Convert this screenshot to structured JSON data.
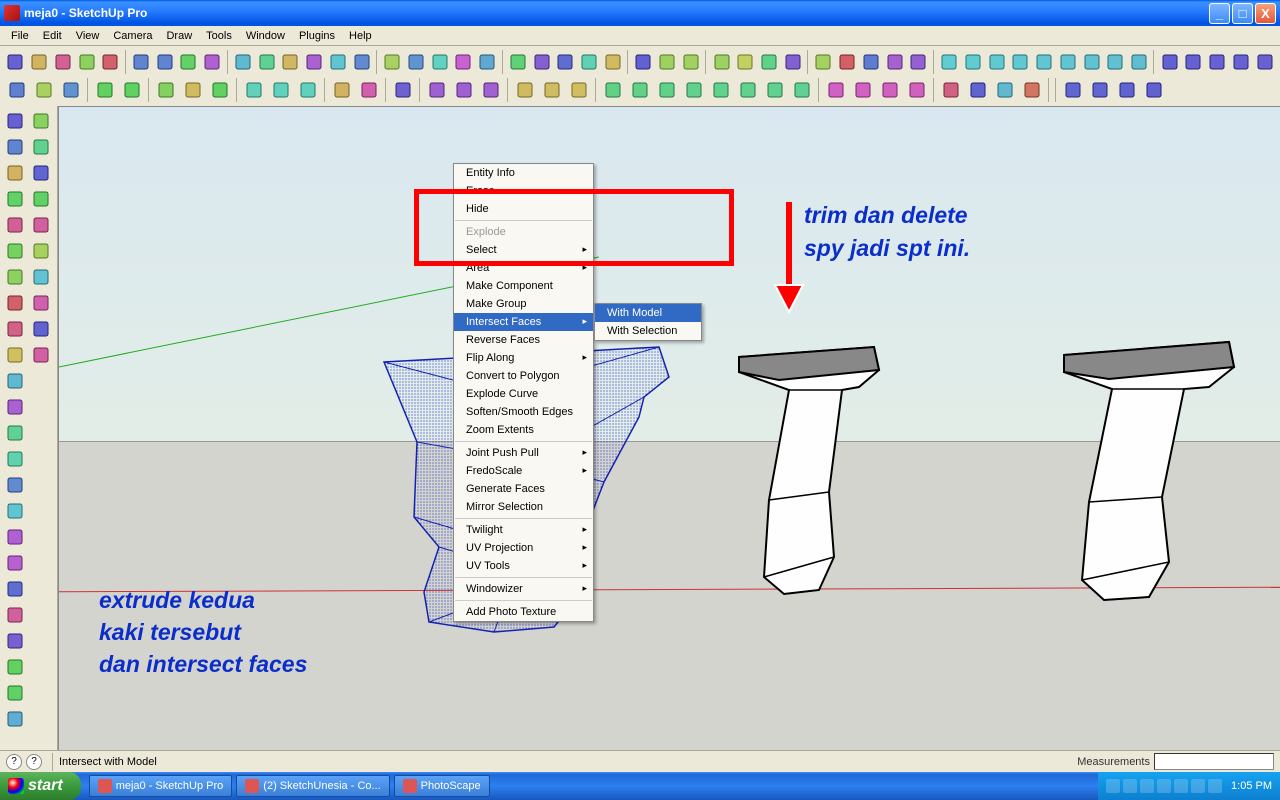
{
  "window": {
    "title": "meja0 - SketchUp Pro"
  },
  "winbtns": {
    "min": "_",
    "max": "□",
    "close": "X"
  },
  "menubar": [
    "File",
    "Edit",
    "View",
    "Camera",
    "Draw",
    "Tools",
    "Window",
    "Plugins",
    "Help"
  ],
  "ctx_main": [
    {
      "label": "Entity Info",
      "type": "item"
    },
    {
      "label": "Erase",
      "type": "item"
    },
    {
      "label": "Hide",
      "type": "item"
    },
    {
      "type": "sep"
    },
    {
      "label": "Explode",
      "type": "item",
      "disabled": true
    },
    {
      "label": "Select",
      "type": "sub"
    },
    {
      "label": "Area",
      "type": "sub"
    },
    {
      "label": "Make Component",
      "type": "item"
    },
    {
      "label": "Make Group",
      "type": "item"
    },
    {
      "label": "Intersect Faces",
      "type": "sub",
      "hover": true
    },
    {
      "label": "Reverse Faces",
      "type": "item"
    },
    {
      "label": "Flip Along",
      "type": "sub"
    },
    {
      "label": "Convert to Polygon",
      "type": "item"
    },
    {
      "label": "Explode Curve",
      "type": "item"
    },
    {
      "label": "Soften/Smooth Edges",
      "type": "item"
    },
    {
      "label": "Zoom Extents",
      "type": "item"
    },
    {
      "type": "sep"
    },
    {
      "label": "Joint Push Pull",
      "type": "sub"
    },
    {
      "label": "FredoScale",
      "type": "sub"
    },
    {
      "label": "Generate Faces",
      "type": "item"
    },
    {
      "label": "Mirror Selection",
      "type": "item"
    },
    {
      "type": "sep"
    },
    {
      "label": "Twilight",
      "type": "sub"
    },
    {
      "label": "UV Projection",
      "type": "sub"
    },
    {
      "label": "UV Tools",
      "type": "sub"
    },
    {
      "type": "sep"
    },
    {
      "label": "Windowizer",
      "type": "sub"
    },
    {
      "type": "sep"
    },
    {
      "label": "Add Photo Texture",
      "type": "item"
    }
  ],
  "ctx_sub": [
    {
      "label": "With Model",
      "hover": true
    },
    {
      "label": "With Selection"
    }
  ],
  "annotations": {
    "right1": "trim dan delete",
    "right2": "spy jadi spt ini.",
    "left1": "extrude kedua",
    "left2": "kaki tersebut",
    "left3": "dan intersect faces"
  },
  "status": {
    "hint": "Intersect with Model",
    "measurements_label": "Measurements"
  },
  "taskbar": {
    "start": "start",
    "tasks": [
      "meja0 - SketchUp Pro",
      "(2) SketchUnesia - Co...",
      "PhotoScape"
    ],
    "clock": "1:05 PM"
  },
  "toolbar_icons_row1": [
    "select",
    "line",
    "rect",
    "circle",
    "arc",
    "sep",
    "component",
    "paint",
    "eraser",
    "tape",
    "sep",
    "move",
    "rotate",
    "rot-tool",
    "pushpull",
    "offset",
    "scale",
    "sep",
    "orbit",
    "pan",
    "zoom",
    "zoom-ext",
    "zoom-win",
    "sep",
    "add-page",
    "styles",
    "layers",
    "scene",
    "shadow",
    "sep",
    "walk",
    "look",
    "section",
    "sep",
    "dim",
    "text",
    "3dtext",
    "axis",
    "sep",
    "undo",
    "redo",
    "cut",
    "copy",
    "paste",
    "sep",
    "box1",
    "box2",
    "box3",
    "box4",
    "box5",
    "box6",
    "box7",
    "box8",
    "box9",
    "sep",
    "house1",
    "house2",
    "house3",
    "house4",
    "house5"
  ],
  "toolbar_icons_row2": [
    "new",
    "open",
    "save",
    "sep",
    "man1",
    "man2",
    "sep",
    "pin",
    "clip",
    "x",
    "sep",
    "book1",
    "book2",
    "book3",
    "sep",
    "panel",
    "ruler",
    "sep",
    "gear",
    "sep",
    "prism1",
    "prism2",
    "prism3",
    "sep",
    "plan1",
    "plan2",
    "plan3",
    "sep",
    "cube1",
    "cube2",
    "cube3",
    "cube4",
    "cube5",
    "cube6",
    "cube7",
    "cube8",
    "sep",
    "cubes1",
    "cubes2",
    "cubes3",
    "cubes4",
    "sep",
    "cyl",
    "curve",
    "fold",
    "info2",
    "sep",
    "sep",
    "diamond1",
    "diamond2",
    "diamond3",
    "diamond4"
  ],
  "left_tools": [
    "select",
    "component",
    "line",
    "eraser",
    "rect",
    "pencil",
    "circle",
    "arc",
    "poly",
    "freehand",
    "move",
    "pushpull",
    "rotate",
    "follow",
    "scale",
    "offset",
    "tape",
    "dimension",
    "protractor",
    "text-tool",
    "axis-tool",
    "3dtext-tool",
    "orbit-tool",
    "pan-tool",
    "zoom-tool",
    "zoomwin",
    "zoomext",
    "prev",
    "position",
    "look-around",
    "walk-tool",
    "section-tool",
    "feet-tool",
    "shadow-tool"
  ],
  "colors": {
    "accent": "#316ac5",
    "anno": "#0b2eca",
    "highlight": "#f00"
  }
}
